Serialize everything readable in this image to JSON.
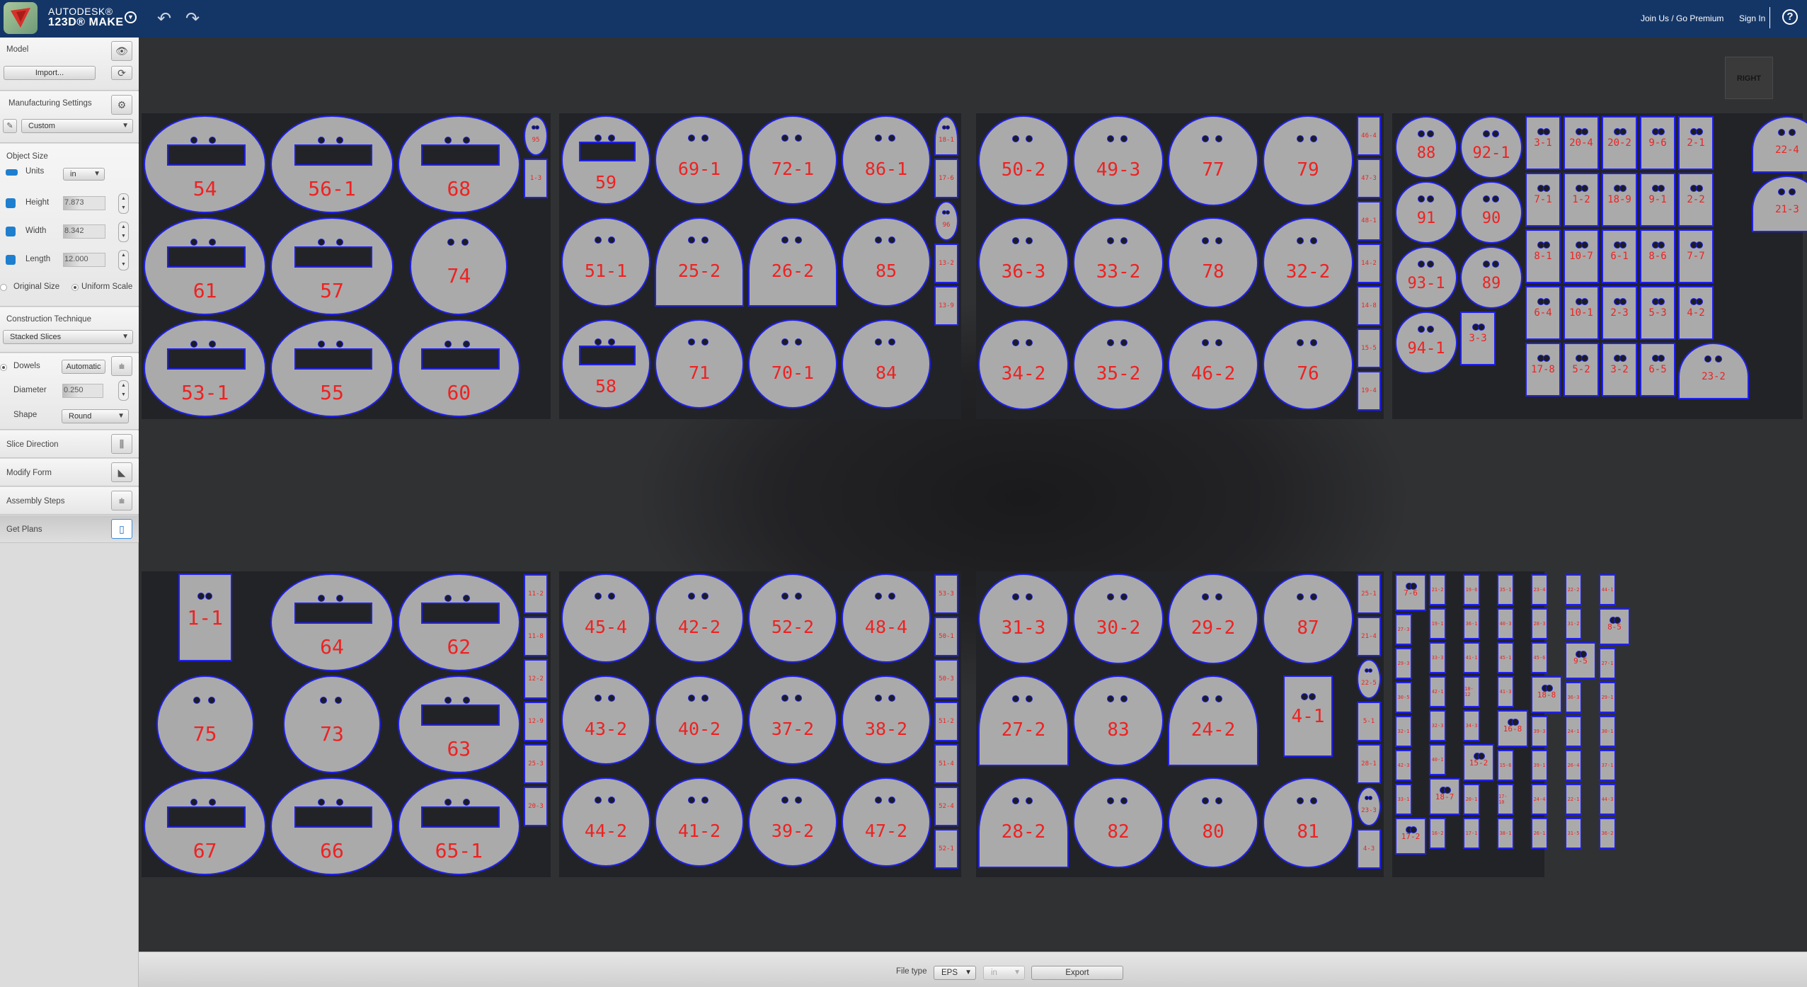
{
  "app": {
    "brand_line1": "AUTODESK®",
    "brand_line2": "123D® MAKE"
  },
  "topbar": {
    "join_label": "Join Us / Go Premium",
    "signin_label": "Sign In",
    "help_label": "?"
  },
  "sidebar": {
    "model_label": "Model",
    "import_label": "Import...",
    "manufacturing_label": "Manufacturing Settings",
    "manufacturing_value": "Custom",
    "object_size_label": "Object Size",
    "units_label": "Units",
    "units_value": "in",
    "height_label": "Height",
    "height_value": "7.873",
    "width_label": "Width",
    "width_value": "8.342",
    "length_label": "Length",
    "length_value": "12.000",
    "original_size_label": "Original Size",
    "uniform_scale_label": "Uniform Scale",
    "uniform_scale_selected": true,
    "construction_label": "Construction Technique",
    "construction_value": "Stacked Slices",
    "dowels_label": "Dowels",
    "dowels_mode": "Automatic",
    "diameter_label": "Diameter",
    "diameter_value": "0.250",
    "shape_label": "Shape",
    "shape_value": "Round",
    "slice_direction_label": "Slice Direction",
    "modify_form_label": "Modify Form",
    "assembly_steps_label": "Assembly Steps",
    "get_plans_label": "Get Plans"
  },
  "viewcube": {
    "face_label": "RIGHT"
  },
  "bottombar": {
    "file_type_label": "File type",
    "file_type_value": "EPS",
    "units_value": "in",
    "export_label": "Export"
  },
  "colors": {
    "topbar": "#143667",
    "part_fill": "#aaaaaa",
    "cut_line": "#2020ee",
    "label": "#ee2222",
    "sheet": "#222327"
  },
  "sheets": [
    {
      "parts": [
        {
          "label": "54",
          "shape": "disk-slot"
        },
        {
          "label": "56-1",
          "shape": "disk-slot"
        },
        {
          "label": "68",
          "shape": "disk-slot"
        },
        {
          "label": "61",
          "shape": "disk-slot"
        },
        {
          "label": "57",
          "shape": "disk-slot"
        },
        {
          "label": "74",
          "shape": "disk"
        },
        {
          "label": "53-1",
          "shape": "disk-slot"
        },
        {
          "label": "55",
          "shape": "disk-slot"
        },
        {
          "label": "60",
          "shape": "disk-slot"
        }
      ],
      "small": [
        {
          "label": "95",
          "shape": "disk"
        },
        {
          "label": "1-3",
          "shape": "rect"
        }
      ]
    },
    {
      "parts": [
        {
          "label": "59",
          "shape": "disk-slot"
        },
        {
          "label": "69-1",
          "shape": "disk"
        },
        {
          "label": "72-1",
          "shape": "disk"
        },
        {
          "label": "86-1",
          "shape": "disk"
        },
        {
          "label": "51-1",
          "shape": "disk"
        },
        {
          "label": "25-2",
          "shape": "arch"
        },
        {
          "label": "26-2",
          "shape": "arch"
        },
        {
          "label": "85",
          "shape": "disk"
        },
        {
          "label": "58",
          "shape": "disk-slot"
        },
        {
          "label": "71",
          "shape": "disk"
        },
        {
          "label": "70-1",
          "shape": "disk"
        },
        {
          "label": "84",
          "shape": "disk"
        }
      ],
      "small": [
        {
          "label": "18-1",
          "shape": "arch"
        },
        {
          "label": "17-6",
          "shape": "rect"
        },
        {
          "label": "96",
          "shape": "disk"
        },
        {
          "label": "13-2",
          "shape": "rect"
        },
        {
          "label": "13-9",
          "shape": "rect"
        }
      ]
    },
    {
      "parts": [
        {
          "label": "50-2",
          "shape": "disk"
        },
        {
          "label": "49-3",
          "shape": "disk"
        },
        {
          "label": "77",
          "shape": "disk"
        },
        {
          "label": "79",
          "shape": "disk"
        },
        {
          "label": "36-3",
          "shape": "disk"
        },
        {
          "label": "33-2",
          "shape": "disk"
        },
        {
          "label": "78",
          "shape": "disk"
        },
        {
          "label": "32-2",
          "shape": "disk"
        },
        {
          "label": "34-2",
          "shape": "disk"
        },
        {
          "label": "35-2",
          "shape": "disk"
        },
        {
          "label": "46-2",
          "shape": "disk"
        },
        {
          "label": "76",
          "shape": "disk"
        }
      ],
      "small": [
        {
          "label": "46-4",
          "shape": "rect"
        },
        {
          "label": "47-3",
          "shape": "rect"
        },
        {
          "label": "48-1",
          "shape": "rect"
        },
        {
          "label": "14-2",
          "shape": "rect"
        },
        {
          "label": "14-8",
          "shape": "rect"
        },
        {
          "label": "15-5",
          "shape": "rect"
        },
        {
          "label": "19-4",
          "shape": "rect"
        }
      ]
    },
    {
      "parts": [
        {
          "label": "88",
          "shape": "disk"
        },
        {
          "label": "91",
          "shape": "disk"
        },
        {
          "label": "93-1",
          "shape": "disk"
        },
        {
          "label": "94-1",
          "shape": "disk"
        },
        {
          "label": "92-1",
          "shape": "disk"
        },
        {
          "label": "90",
          "shape": "disk"
        },
        {
          "label": "89",
          "shape": "disk"
        },
        {
          "label": "3-3",
          "shape": "rect"
        },
        {
          "label": "3-1",
          "shape": "rect"
        },
        {
          "label": "7-1",
          "shape": "rect"
        },
        {
          "label": "8-1",
          "shape": "rect"
        },
        {
          "label": "6-4",
          "shape": "rect"
        },
        {
          "label": "17-8",
          "shape": "rect"
        },
        {
          "label": "20-4",
          "shape": "rect"
        },
        {
          "label": "1-2",
          "shape": "rect"
        },
        {
          "label": "10-7",
          "shape": "rect"
        },
        {
          "label": "10-1",
          "shape": "rect"
        },
        {
          "label": "5-2",
          "shape": "rect"
        },
        {
          "label": "20-2",
          "shape": "rect"
        },
        {
          "label": "18-9",
          "shape": "rect"
        },
        {
          "label": "6-1",
          "shape": "rect"
        },
        {
          "label": "2-3",
          "shape": "rect"
        },
        {
          "label": "3-2",
          "shape": "rect"
        },
        {
          "label": "9-6",
          "shape": "rect"
        },
        {
          "label": "9-1",
          "shape": "rect"
        },
        {
          "label": "8-6",
          "shape": "rect"
        },
        {
          "label": "5-3",
          "shape": "rect"
        },
        {
          "label": "6-5",
          "shape": "rect"
        },
        {
          "label": "2-1",
          "shape": "rect"
        },
        {
          "label": "2-2",
          "shape": "rect"
        },
        {
          "label": "7-7",
          "shape": "rect"
        },
        {
          "label": "4-2",
          "shape": "rect"
        },
        {
          "label": "23-2",
          "shape": "arch"
        },
        {
          "label": "22-4",
          "shape": "arch"
        },
        {
          "label": "21-3",
          "shape": "arch"
        }
      ],
      "small": []
    },
    {
      "parts": [
        {
          "label": "1-1",
          "shape": "rect"
        },
        {
          "label": "64",
          "shape": "disk-slot"
        },
        {
          "label": "62",
          "shape": "disk-slot"
        },
        {
          "label": "75",
          "shape": "disk"
        },
        {
          "label": "73",
          "shape": "disk"
        },
        {
          "label": "63",
          "shape": "disk-slot"
        },
        {
          "label": "67",
          "shape": "disk-slot"
        },
        {
          "label": "66",
          "shape": "disk-slot"
        },
        {
          "label": "65-1",
          "shape": "disk-slot"
        }
      ],
      "small": [
        {
          "label": "11-2",
          "shape": "rect"
        },
        {
          "label": "11-8",
          "shape": "rect"
        },
        {
          "label": "12-2",
          "shape": "rect"
        },
        {
          "label": "12-9",
          "shape": "rect"
        },
        {
          "label": "25-3",
          "shape": "rect"
        },
        {
          "label": "20-3",
          "shape": "rect"
        }
      ]
    },
    {
      "parts": [
        {
          "label": "45-4",
          "shape": "disk"
        },
        {
          "label": "42-2",
          "shape": "disk"
        },
        {
          "label": "52-2",
          "shape": "disk"
        },
        {
          "label": "48-4",
          "shape": "disk"
        },
        {
          "label": "43-2",
          "shape": "disk"
        },
        {
          "label": "40-2",
          "shape": "disk"
        },
        {
          "label": "37-2",
          "shape": "disk"
        },
        {
          "label": "38-2",
          "shape": "disk"
        },
        {
          "label": "44-2",
          "shape": "disk"
        },
        {
          "label": "41-2",
          "shape": "disk"
        },
        {
          "label": "39-2",
          "shape": "disk"
        },
        {
          "label": "47-2",
          "shape": "disk"
        }
      ],
      "small": [
        {
          "label": "53-3",
          "shape": "rect"
        },
        {
          "label": "50-1",
          "shape": "rect"
        },
        {
          "label": "50-3",
          "shape": "rect"
        },
        {
          "label": "51-2",
          "shape": "rect"
        },
        {
          "label": "51-4",
          "shape": "rect"
        },
        {
          "label": "52-4",
          "shape": "rect"
        },
        {
          "label": "52-1",
          "shape": "rect"
        }
      ]
    },
    {
      "parts": [
        {
          "label": "31-3",
          "shape": "disk"
        },
        {
          "label": "30-2",
          "shape": "disk"
        },
        {
          "label": "29-2",
          "shape": "disk"
        },
        {
          "label": "87",
          "shape": "disk"
        },
        {
          "label": "27-2",
          "shape": "arch"
        },
        {
          "label": "83",
          "shape": "disk"
        },
        {
          "label": "24-2",
          "shape": "arch"
        },
        {
          "label": "4-1",
          "shape": "rect"
        },
        {
          "label": "28-2",
          "shape": "arch"
        },
        {
          "label": "82",
          "shape": "disk"
        },
        {
          "label": "80",
          "shape": "disk"
        },
        {
          "label": "81",
          "shape": "disk"
        }
      ],
      "small": [
        {
          "label": "25-1",
          "shape": "rect"
        },
        {
          "label": "21-4",
          "shape": "rect"
        },
        {
          "label": "22-5",
          "shape": "disk"
        },
        {
          "label": "5-1",
          "shape": "rect"
        },
        {
          "label": "28-1",
          "shape": "rect"
        },
        {
          "label": "23-3",
          "shape": "disk"
        },
        {
          "label": "4-3",
          "shape": "rect"
        }
      ]
    },
    {
      "parts": [
        {
          "label": "7-6",
          "shape": "rect"
        },
        {
          "label": "27-3",
          "shape": "rect"
        },
        {
          "label": "29-3",
          "shape": "rect"
        },
        {
          "label": "30-5",
          "shape": "rect"
        },
        {
          "label": "32-1",
          "shape": "rect"
        },
        {
          "label": "42-3",
          "shape": "rect"
        },
        {
          "label": "33-1",
          "shape": "rect"
        },
        {
          "label": "17-2",
          "shape": "rect"
        },
        {
          "label": "21-2",
          "shape": "rect"
        },
        {
          "label": "19-1",
          "shape": "rect"
        },
        {
          "label": "33-3",
          "shape": "rect"
        },
        {
          "label": "42-1",
          "shape": "rect"
        },
        {
          "label": "32-3",
          "shape": "rect"
        },
        {
          "label": "40-1",
          "shape": "rect"
        },
        {
          "label": "18-7",
          "shape": "rect"
        },
        {
          "label": "16-2",
          "shape": "rect"
        },
        {
          "label": "19-6",
          "shape": "rect"
        },
        {
          "label": "36-1",
          "shape": "rect"
        },
        {
          "label": "41-1",
          "shape": "rect"
        },
        {
          "label": "18-12",
          "shape": "rect"
        },
        {
          "label": "34-3",
          "shape": "rect"
        },
        {
          "label": "15-2",
          "shape": "rect"
        },
        {
          "label": "20-1",
          "shape": "rect"
        },
        {
          "label": "17-1",
          "shape": "rect"
        },
        {
          "label": "35-1",
          "shape": "rect"
        },
        {
          "label": "40-3",
          "shape": "rect"
        },
        {
          "label": "45-1",
          "shape": "rect"
        },
        {
          "label": "41-3",
          "shape": "rect"
        },
        {
          "label": "16-8",
          "shape": "rect"
        },
        {
          "label": "15-6",
          "shape": "rect"
        },
        {
          "label": "17-10",
          "shape": "rect"
        },
        {
          "label": "38-1",
          "shape": "rect"
        },
        {
          "label": "23-4",
          "shape": "rect"
        },
        {
          "label": "28-3",
          "shape": "rect"
        },
        {
          "label": "45-6",
          "shape": "rect"
        },
        {
          "label": "18-8",
          "shape": "rect"
        },
        {
          "label": "39-3",
          "shape": "rect"
        },
        {
          "label": "39-1",
          "shape": "rect"
        },
        {
          "label": "24-4",
          "shape": "rect"
        },
        {
          "label": "26-1",
          "shape": "rect"
        },
        {
          "label": "22-2",
          "shape": "rect"
        },
        {
          "label": "31-2",
          "shape": "rect"
        },
        {
          "label": "9-5",
          "shape": "rect"
        },
        {
          "label": "36-3",
          "shape": "rect"
        },
        {
          "label": "24-1",
          "shape": "rect"
        },
        {
          "label": "26-4",
          "shape": "rect"
        },
        {
          "label": "22-1",
          "shape": "rect"
        },
        {
          "label": "31-5",
          "shape": "rect"
        },
        {
          "label": "44-1",
          "shape": "rect"
        },
        {
          "label": "8-5",
          "shape": "rect"
        },
        {
          "label": "27-1",
          "shape": "rect"
        },
        {
          "label": "29-1",
          "shape": "rect"
        },
        {
          "label": "30-1",
          "shape": "rect"
        },
        {
          "label": "37-1",
          "shape": "rect"
        },
        {
          "label": "44-3",
          "shape": "rect"
        },
        {
          "label": "36-2",
          "shape": "rect"
        }
      ],
      "small": []
    }
  ]
}
